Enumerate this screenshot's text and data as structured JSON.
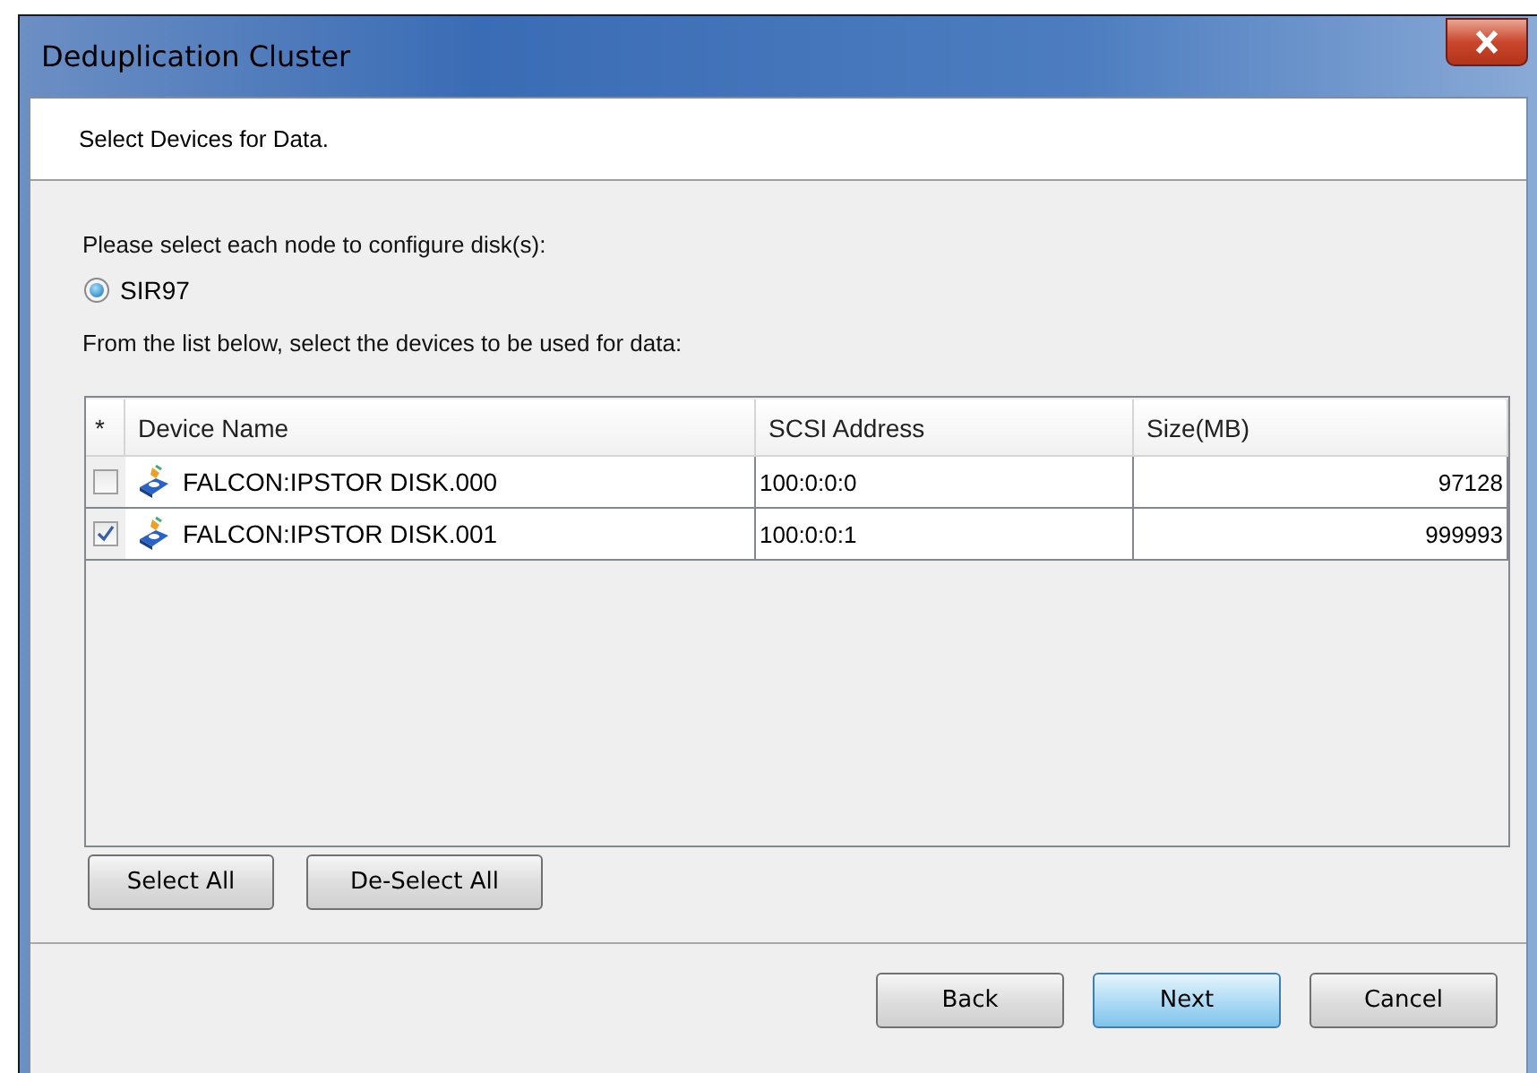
{
  "window": {
    "title": "Deduplication Cluster"
  },
  "header": "Select Devices for Data.",
  "node_prompt": "Please select each node to configure disk(s):",
  "nodes": [
    {
      "label": "SIR97",
      "selected": true
    }
  ],
  "device_prompt": "From the list below, select the devices to be used for data:",
  "table": {
    "columns": [
      "*",
      "Device Name",
      "SCSI Address",
      "Size(MB)"
    ],
    "rows": [
      {
        "checked": false,
        "name": "FALCON:IPSTOR DISK.000",
        "address": "100:0:0:0",
        "size": "97128"
      },
      {
        "checked": true,
        "name": "FALCON:IPSTOR DISK.001",
        "address": "100:0:0:1",
        "size": "999993"
      }
    ]
  },
  "list_buttons": [
    "Select All",
    "De-Select All"
  ],
  "footer_buttons": [
    {
      "label": "Back",
      "default": false
    },
    {
      "label": "Next",
      "default": true
    },
    {
      "label": "Cancel",
      "default": false
    }
  ]
}
